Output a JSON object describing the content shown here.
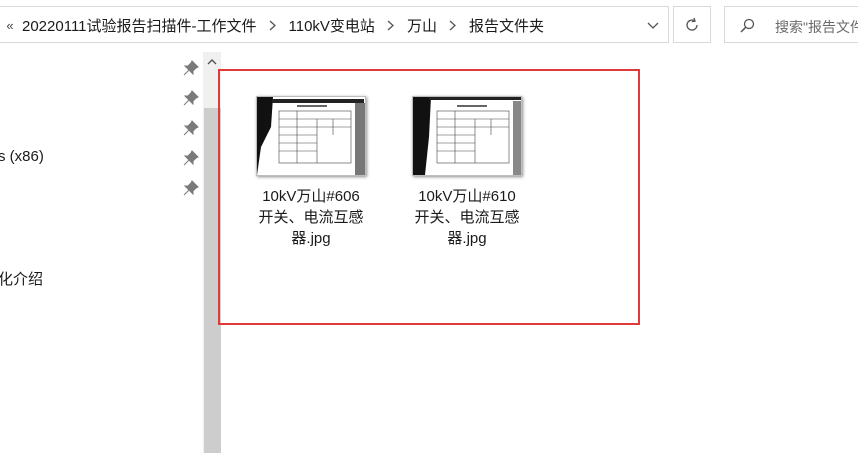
{
  "address_bar": {
    "overflow": "«",
    "crumbs": [
      "20220111试验报告扫描件-工作文件",
      "110kV变电站",
      "万山",
      "报告文件夹"
    ]
  },
  "search": {
    "placeholder": "搜索\"报告文件"
  },
  "nav": {
    "items": [
      "s (x86)",
      "化介绍"
    ]
  },
  "files": [
    {
      "name_line1": "10kV万山#606",
      "name_line2": "开关、电流互感",
      "name_line3": "器.jpg"
    },
    {
      "name_line1": "10kV万山#610",
      "name_line2": "开关、电流互感",
      "name_line3": "器.jpg"
    }
  ],
  "colors": {
    "highlight": "#e03a3a",
    "border": "#d9d9d9"
  }
}
